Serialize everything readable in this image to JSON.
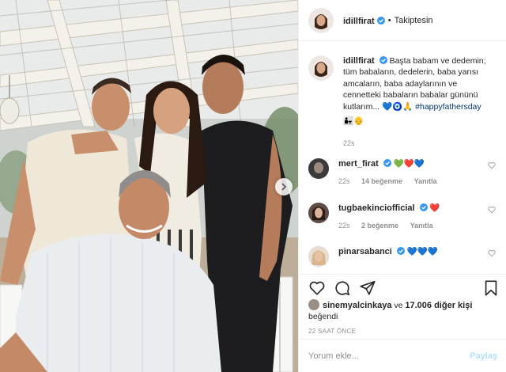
{
  "post": {
    "author": "idillfirat",
    "follow_state": "Takiptesin",
    "separator": "•",
    "caption_author": "idillfirat",
    "caption_text": "Başta babam ve dedemin; tüm babaların, dedelerin, baba yarısı amcaların, baba adaylarının ve cennetteki babaların babalar gününü kutlarım... 💙🧿🙏",
    "hashtag": "#happyfathersday",
    "caption_emojis": "👨‍👧👴",
    "caption_time": "22s"
  },
  "comments": [
    {
      "user": "mert_firat",
      "text": "💚❤️💙",
      "time": "22s",
      "likes": "14 beğenme",
      "reply": "Yanıtla"
    },
    {
      "user": "tugbaekinciofficial",
      "text": "❤️",
      "time": "22s",
      "likes": "2 beğenme",
      "reply": "Yanıtla"
    },
    {
      "user": "pinarsabanci",
      "text": "💙💙💙",
      "time": "",
      "likes": "",
      "reply": ""
    }
  ],
  "likes_summary": {
    "first_user": "sinemyalcinkaya",
    "connector": "ve",
    "others": "17.006 diğer kişi",
    "suffix": "beğendi"
  },
  "posted_ago": "22 SAAT ÖNCE",
  "add_comment": {
    "placeholder": "Yorum ekle...",
    "post_label": "Paylaş"
  },
  "icons": {
    "verified": "verified-badge-icon",
    "like": "heart-outline-icon",
    "comment": "comment-bubble-icon",
    "share": "paper-plane-icon",
    "save": "bookmark-icon",
    "carousel": "chevron-right-icon"
  },
  "colors": {
    "verified": "#3897f0",
    "link": "#00376b",
    "meta": "#8e8e8e",
    "post_disabled": "#b2dffc"
  }
}
